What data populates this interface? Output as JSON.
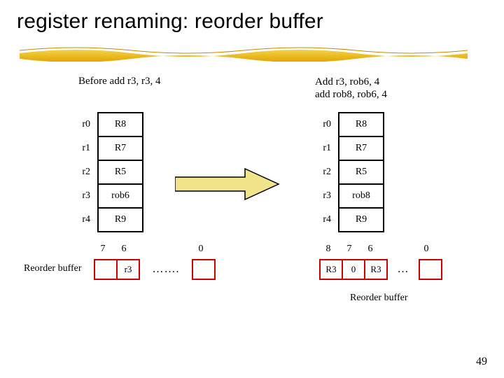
{
  "title": "register renaming: reorder buffer",
  "left": {
    "caption": "Before add r3, r3, 4",
    "rows": [
      {
        "name": "r0",
        "val": "R8"
      },
      {
        "name": "r1",
        "val": "R7"
      },
      {
        "name": "r2",
        "val": "R5"
      },
      {
        "name": "r3",
        "val": "rob6"
      },
      {
        "name": "r4",
        "val": "R9"
      }
    ],
    "rob_label": "Reorder buffer",
    "rob_indices": {
      "i7": "7",
      "i6": "6",
      "i0": "0"
    },
    "rob_cells": {
      "c6": "r3"
    }
  },
  "right": {
    "caption": "Add r3, rob6, 4\nadd rob8, rob6, 4",
    "rows": [
      {
        "name": "r0",
        "val": "R8"
      },
      {
        "name": "r1",
        "val": "R7"
      },
      {
        "name": "r2",
        "val": "R5"
      },
      {
        "name": "r3",
        "val": "rob8"
      },
      {
        "name": "r4",
        "val": "R9"
      }
    ],
    "rob_label": "Reorder buffer",
    "rob_indices": {
      "i8": "8",
      "i7": "7",
      "i6": "6",
      "i0": "0"
    },
    "rob_cells": {
      "c8": "R3",
      "c7": "0",
      "c6": "R3"
    }
  },
  "ellipsis": "…….",
  "ellipsis2": "…",
  "page": "49"
}
